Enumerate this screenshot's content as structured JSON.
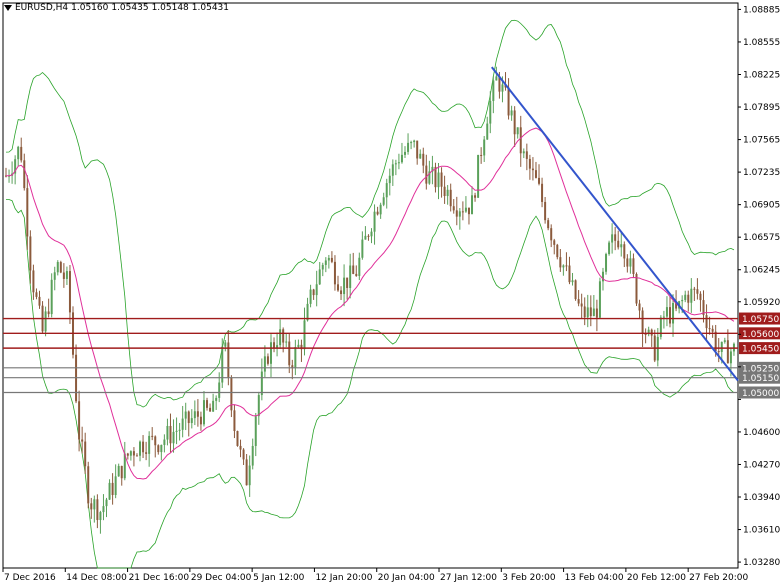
{
  "header": {
    "symbol": "EURUSD,H4",
    "open": "1.05160",
    "high": "1.05435",
    "low": "1.05148",
    "close": "1.05431"
  },
  "colors": {
    "background": "#ffffff",
    "bull_candle": "#5aa05a",
    "bear_candle": "#8b5a3c",
    "moving_average": "#e0309a",
    "bollinger": "#29a329",
    "trendline": "#3355cc",
    "resistance_line": "#a01c1c",
    "support_line": "#777777"
  },
  "chart_data": {
    "type": "candlestick",
    "symbol": "EURUSD",
    "timeframe": "H4",
    "y_axis_ticks": [
      "1.08885",
      "1.08555",
      "1.08225",
      "1.07895",
      "1.07565",
      "1.07235",
      "1.06905",
      "1.06575",
      "1.06245",
      "1.05920",
      "1.05590",
      "1.05260",
      "1.04930",
      "1.04600",
      "1.04270",
      "1.03940",
      "1.03610",
      "1.03280"
    ],
    "y_range": [
      1.0322,
      1.0895
    ],
    "x_axis_ticks": [
      "7 Dec 2016",
      "14 Dec 08:00",
      "21 Dec 16:00",
      "29 Dec 04:00",
      "5 Jan 12:00",
      "12 Jan 20:00",
      "20 Jan 04:00",
      "27 Jan 12:00",
      "3 Feb 20:00",
      "13 Feb 04:00",
      "20 Feb 12:00",
      "27 Feb 20:00"
    ],
    "price_levels": [
      {
        "label": "1.05750",
        "value": 1.0575,
        "kind": "resistance"
      },
      {
        "label": "1.05600",
        "value": 1.056,
        "kind": "resistance"
      },
      {
        "label": "1.05450",
        "value": 1.0545,
        "kind": "resistance"
      },
      {
        "label": "1.05250",
        "value": 1.0525,
        "kind": "support"
      },
      {
        "label": "1.05150",
        "value": 1.0515,
        "kind": "support"
      },
      {
        "label": "1.05000",
        "value": 1.05,
        "kind": "support"
      }
    ],
    "trendline": {
      "from_label": "27 Jan 12:00",
      "from_value": 1.083,
      "to_label": "27 Feb 20:00",
      "to_value": 1.0512
    },
    "price_path": [
      [
        0,
        1.072
      ],
      [
        0.02,
        1.075
      ],
      [
        0.035,
        1.062
      ],
      [
        0.05,
        1.056
      ],
      [
        0.07,
        1.063
      ],
      [
        0.085,
        1.061
      ],
      [
        0.1,
        1.046
      ],
      [
        0.115,
        1.039
      ],
      [
        0.13,
        1.038
      ],
      [
        0.15,
        1.041
      ],
      [
        0.17,
        1.044
      ],
      [
        0.19,
        1.045
      ],
      [
        0.21,
        1.045
      ],
      [
        0.23,
        1.046
      ],
      [
        0.25,
        1.047
      ],
      [
        0.27,
        1.048
      ],
      [
        0.285,
        1.048
      ],
      [
        0.3,
        1.055
      ],
      [
        0.315,
        1.046
      ],
      [
        0.33,
        1.041
      ],
      [
        0.345,
        1.049
      ],
      [
        0.36,
        1.054
      ],
      [
        0.375,
        1.056
      ],
      [
        0.39,
        1.053
      ],
      [
        0.405,
        1.055
      ],
      [
        0.42,
        1.06
      ],
      [
        0.44,
        1.064
      ],
      [
        0.46,
        1.061
      ],
      [
        0.48,
        1.062
      ],
      [
        0.5,
        1.067
      ],
      [
        0.52,
        1.071
      ],
      [
        0.54,
        1.074
      ],
      [
        0.56,
        1.075
      ],
      [
        0.58,
        1.072
      ],
      [
        0.6,
        1.071
      ],
      [
        0.62,
        1.069
      ],
      [
        0.64,
        1.069
      ],
      [
        0.66,
        1.078
      ],
      [
        0.675,
        1.082
      ],
      [
        0.69,
        1.079
      ],
      [
        0.71,
        1.074
      ],
      [
        0.73,
        1.071
      ],
      [
        0.75,
        1.066
      ],
      [
        0.77,
        1.062
      ],
      [
        0.79,
        1.058
      ],
      [
        0.81,
        1.058
      ],
      [
        0.83,
        1.065
      ],
      [
        0.845,
        1.066
      ],
      [
        0.86,
        1.062
      ],
      [
        0.875,
        1.057
      ],
      [
        0.89,
        1.054
      ],
      [
        0.905,
        1.058
      ],
      [
        0.92,
        1.058
      ],
      [
        0.935,
        1.06
      ],
      [
        0.95,
        1.06
      ],
      [
        0.965,
        1.057
      ],
      [
        0.98,
        1.054
      ],
      [
        1.0,
        1.0543
      ]
    ]
  }
}
